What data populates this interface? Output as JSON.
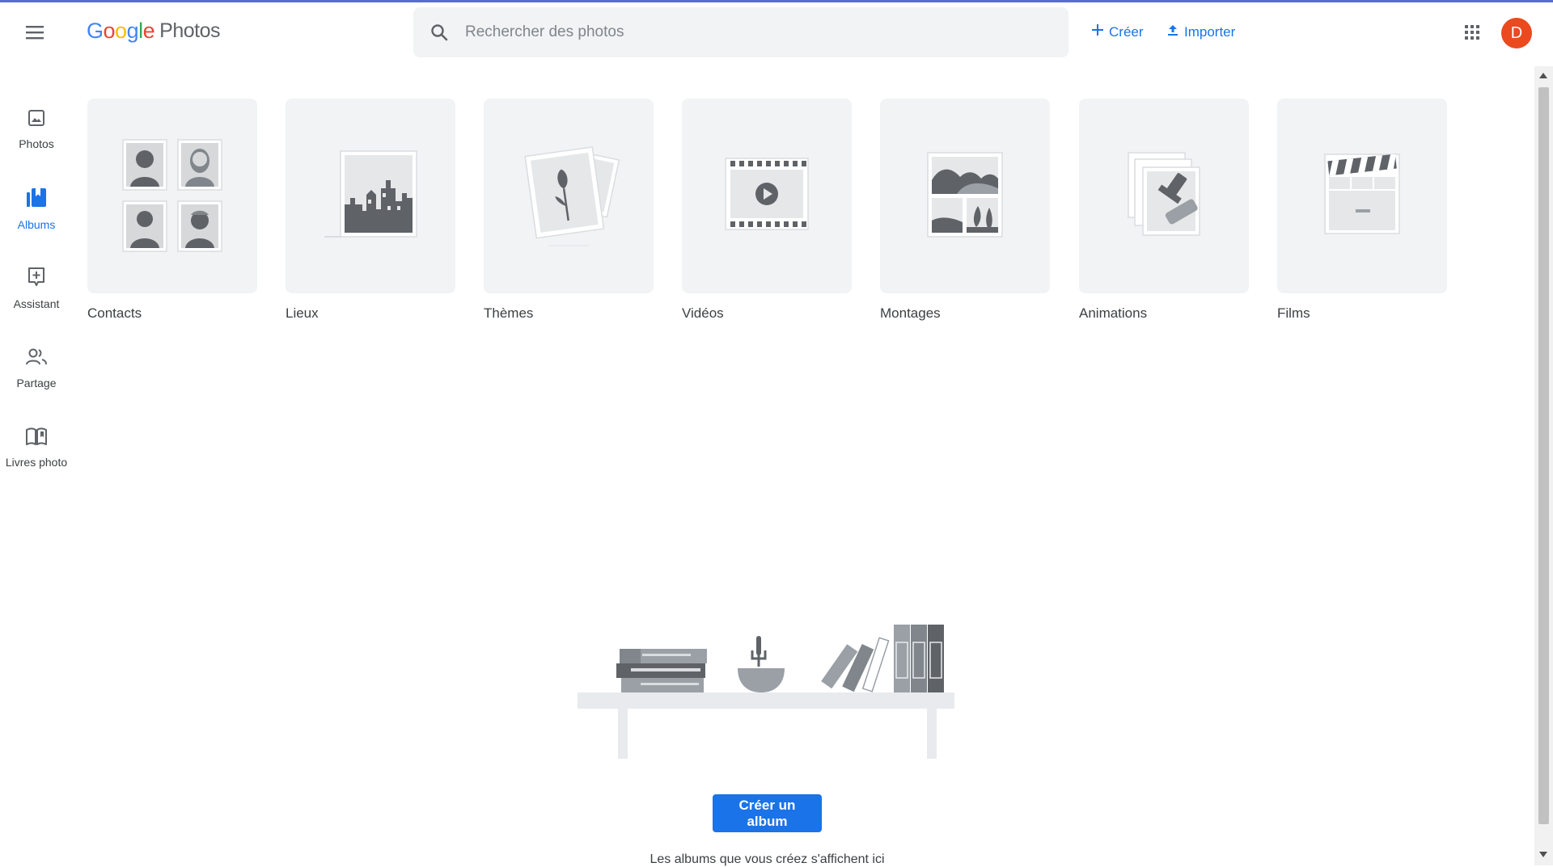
{
  "colors": {
    "accent": "#1a73e8",
    "avatar_bg": "#ea4a1e",
    "tile_bg": "#f1f3f4"
  },
  "header": {
    "logo_google": [
      "G",
      "o",
      "o",
      "g",
      "l",
      "e"
    ],
    "logo_product": "Photos",
    "search_placeholder": "Rechercher des photos",
    "create_label": "Créer",
    "import_label": "Importer",
    "avatar_letter": "D",
    "icons": [
      "menu-icon",
      "search-icon",
      "plus-icon",
      "upload-icon",
      "apps-grid-icon"
    ]
  },
  "nav": {
    "items": [
      {
        "label": "Photos",
        "icon": "photo-icon"
      },
      {
        "label": "Albums",
        "icon": "albums-icon",
        "active": true
      },
      {
        "label": "Assistant",
        "icon": "assistant-icon"
      },
      {
        "label": "Partage",
        "icon": "people-icon"
      },
      {
        "label": "Livres photo",
        "icon": "book-icon"
      }
    ]
  },
  "categories": [
    {
      "label": "Contacts",
      "icon": "contacts-icon"
    },
    {
      "label": "Lieux",
      "icon": "places-icon"
    },
    {
      "label": "Thèmes",
      "icon": "things-icon"
    },
    {
      "label": "Vidéos",
      "icon": "video-icon"
    },
    {
      "label": "Montages",
      "icon": "collage-icon"
    },
    {
      "label": "Animations",
      "icon": "animation-icon"
    },
    {
      "label": "Films",
      "icon": "movie-clapper-icon"
    }
  ],
  "empty_state": {
    "button_label": "Créer un album",
    "message": "Les albums que vous créez s'affichent ici"
  }
}
